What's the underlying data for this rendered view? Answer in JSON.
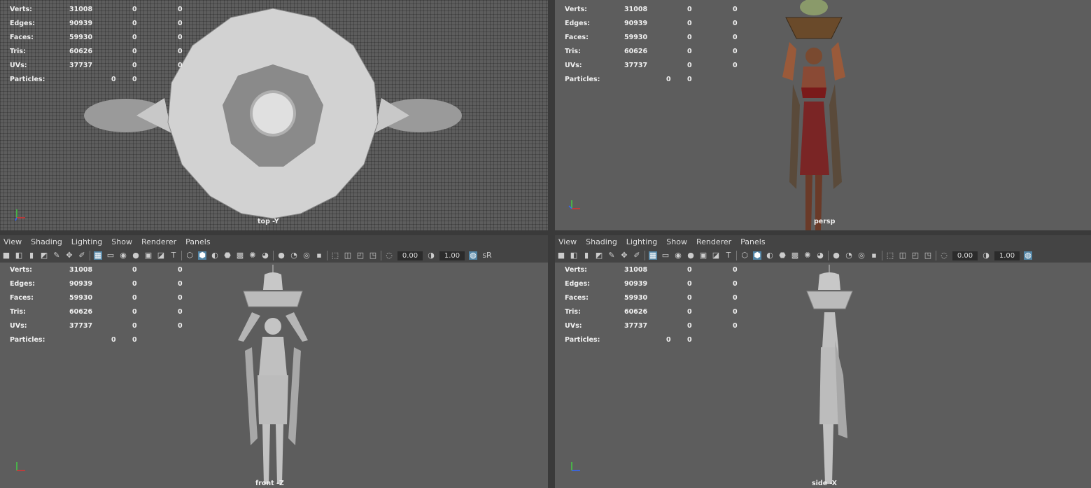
{
  "hud": {
    "verts": {
      "label": "Verts:",
      "v1": "31008",
      "v2": "0",
      "v3": "0"
    },
    "edges": {
      "label": "Edges:",
      "v1": "90939",
      "v2": "0",
      "v3": "0"
    },
    "faces": {
      "label": "Faces:",
      "v1": "59930",
      "v2": "0",
      "v3": "0"
    },
    "tris": {
      "label": "Tris:",
      "v1": "60626",
      "v2": "0",
      "v3": "0"
    },
    "uvs": {
      "label": "UVs:",
      "v1": "37737",
      "v2": "0",
      "v3": "0"
    },
    "particles": {
      "label": "Particles:",
      "v2": "0",
      "v3": "0"
    }
  },
  "menu": {
    "view": "View",
    "shading": "Shading",
    "lighting": "Lighting",
    "show": "Show",
    "renderer": "Renderer",
    "panels": "Panels"
  },
  "toolbar": {
    "exposure": "0.00",
    "gamma": "1.00",
    "colorspace": "sR"
  },
  "viewports": {
    "top": "top -Y",
    "persp": "persp",
    "front": "front -Z",
    "side": "side -X"
  },
  "colors": {
    "accent": "#5285a6",
    "viewport_bg": "#5d5d5d",
    "panel_bg": "#444444"
  }
}
